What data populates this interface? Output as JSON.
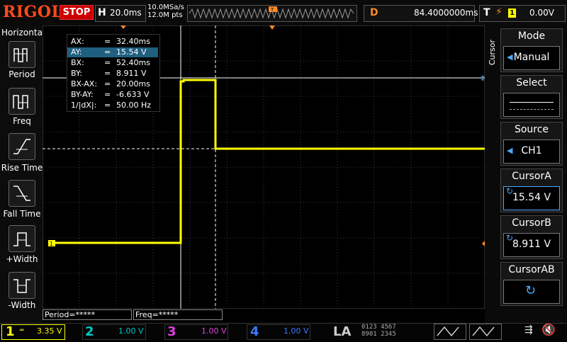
{
  "brand": "RIGOL",
  "run_state": "STOP",
  "horizontal": {
    "letter": "H",
    "timebase": "20.0ms",
    "sample_rate": "10.0MSa/s",
    "points": "12.0M pts"
  },
  "delay": {
    "letter": "D",
    "value": "84.4000000ms"
  },
  "trigger": {
    "letter": "T",
    "edge_icon": "rising-edge-icon",
    "channel": "1",
    "level": "0.00V"
  },
  "left_panel": {
    "title": "Horizontal",
    "items": [
      {
        "label": "Period",
        "icon": "period-icon"
      },
      {
        "label": "Freq",
        "icon": "frequency-icon"
      },
      {
        "label": "Rise Time",
        "icon": "rise-time-icon"
      },
      {
        "label": "Fall Time",
        "icon": "fall-time-icon"
      },
      {
        "label": "+Width",
        "icon": "positive-width-icon"
      },
      {
        "label": "-Width",
        "icon": "negative-width-icon"
      }
    ]
  },
  "cursor_table": [
    {
      "key": "AX:",
      "eq": "=",
      "value": "32.40ms"
    },
    {
      "key": "AY:",
      "eq": "=",
      "value": "15.54 V"
    },
    {
      "key": "BX:",
      "eq": "=",
      "value": "52.40ms"
    },
    {
      "key": "BY:",
      "eq": "=",
      "value": "8.911 V"
    },
    {
      "key": "BX-AX:",
      "eq": "=",
      "value": "20.00ms"
    },
    {
      "key": "BY-AY:",
      "eq": "=",
      "value": "-6.633 V"
    },
    {
      "key": "1/|dX|:",
      "eq": "=",
      "value": "50.00 Hz"
    }
  ],
  "right_panel": {
    "vertical_label": "Cursor",
    "mode": {
      "title": "Mode",
      "value": "Manual"
    },
    "select": {
      "title": "Select"
    },
    "source": {
      "title": "Source",
      "value": "CH1"
    },
    "cursor_a": {
      "title": "CursorA",
      "value": "15.54 V"
    },
    "cursor_b": {
      "title": "CursorB",
      "value": "8.911 V"
    },
    "cursor_ab": {
      "title": "CursorAB"
    }
  },
  "measure_status": {
    "period": "Period=*****",
    "freq": "Freq=*****"
  },
  "channels": [
    {
      "num": "1",
      "scale": "3.35 V",
      "color": "#ffff00",
      "active": true
    },
    {
      "num": "2",
      "scale": "1.00 V",
      "color": "#00c8c8",
      "active": false
    },
    {
      "num": "3",
      "scale": "1.00 V",
      "color": "#e040e0",
      "active": false
    },
    {
      "num": "4",
      "scale": "1.00 V",
      "color": "#3a7cff",
      "active": false
    }
  ],
  "la_label": "LA",
  "la_digits_top": "0123 4567",
  "la_digits_bottom": "8901 2345",
  "colors": {
    "trace": "#ffff00",
    "accent": "#ff8a28",
    "stop": "#cc0000"
  }
}
